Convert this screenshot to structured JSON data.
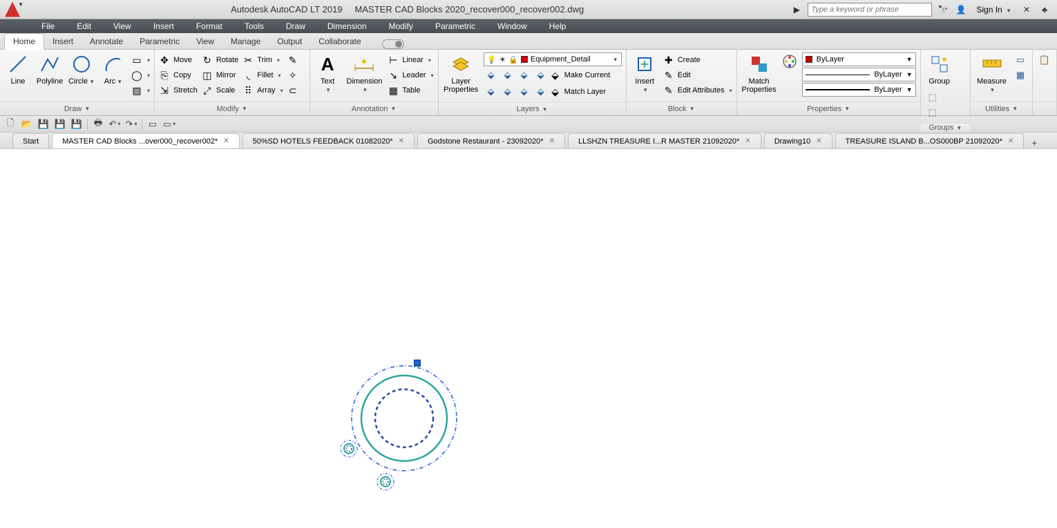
{
  "title": {
    "app": "Autodesk AutoCAD LT 2019",
    "doc": "MASTER CAD Blocks 2020_recover000_recover002.dwg"
  },
  "search": {
    "placeholder": "Type a keyword or phrase",
    "signin": "Sign In"
  },
  "menubar": [
    "File",
    "Edit",
    "View",
    "Insert",
    "Format",
    "Tools",
    "Draw",
    "Dimension",
    "Modify",
    "Parametric",
    "Window",
    "Help"
  ],
  "ribbon_tabs": [
    "Home",
    "Insert",
    "Annotate",
    "Parametric",
    "View",
    "Manage",
    "Output",
    "Collaborate"
  ],
  "panels": {
    "draw": {
      "title": "Draw",
      "line": "Line",
      "polyline": "Polyline",
      "circle": "Circle",
      "arc": "Arc"
    },
    "modify": {
      "title": "Modify",
      "move": "Move",
      "rotate": "Rotate",
      "trim": "Trim",
      "copy": "Copy",
      "mirror": "Mirror",
      "fillet": "Fillet",
      "stretch": "Stretch",
      "scale": "Scale",
      "array": "Array"
    },
    "annotation": {
      "title": "Annotation",
      "text": "Text",
      "dimension": "Dimension",
      "linear": "Linear",
      "leader": "Leader",
      "table": "Table"
    },
    "layers": {
      "title": "Layers",
      "layerprops": "Layer\nProperties",
      "current_layer": "Equipment_Detail",
      "make_current": "Make Current",
      "match_layer": "Match Layer"
    },
    "block": {
      "title": "Block",
      "insert": "Insert",
      "create": "Create",
      "edit": "Edit",
      "edit_attr": "Edit Attributes"
    },
    "properties": {
      "title": "Properties",
      "match": "Match\nProperties",
      "color": "ByLayer",
      "ltype": "ByLayer",
      "lweight": "ByLayer"
    },
    "groups": {
      "title": "Groups",
      "group": "Group"
    },
    "utilities": {
      "title": "Utilities",
      "measure": "Measure"
    }
  },
  "doc_tabs": [
    {
      "label": "Start",
      "closable": false
    },
    {
      "label": "MASTER CAD Blocks ...over000_recover002*",
      "closable": true,
      "active": true
    },
    {
      "label": "50%SD HOTELS FEEDBACK 01082020*",
      "closable": true
    },
    {
      "label": "Godstone Restaurant - 23092020*",
      "closable": true
    },
    {
      "label": "LLSHZN TREASURE I...R MASTER 21092020*",
      "closable": true
    },
    {
      "label": "Drawing10",
      "closable": true
    },
    {
      "label": "TREASURE ISLAND B...OS000BP 21092020*",
      "closable": true
    }
  ]
}
